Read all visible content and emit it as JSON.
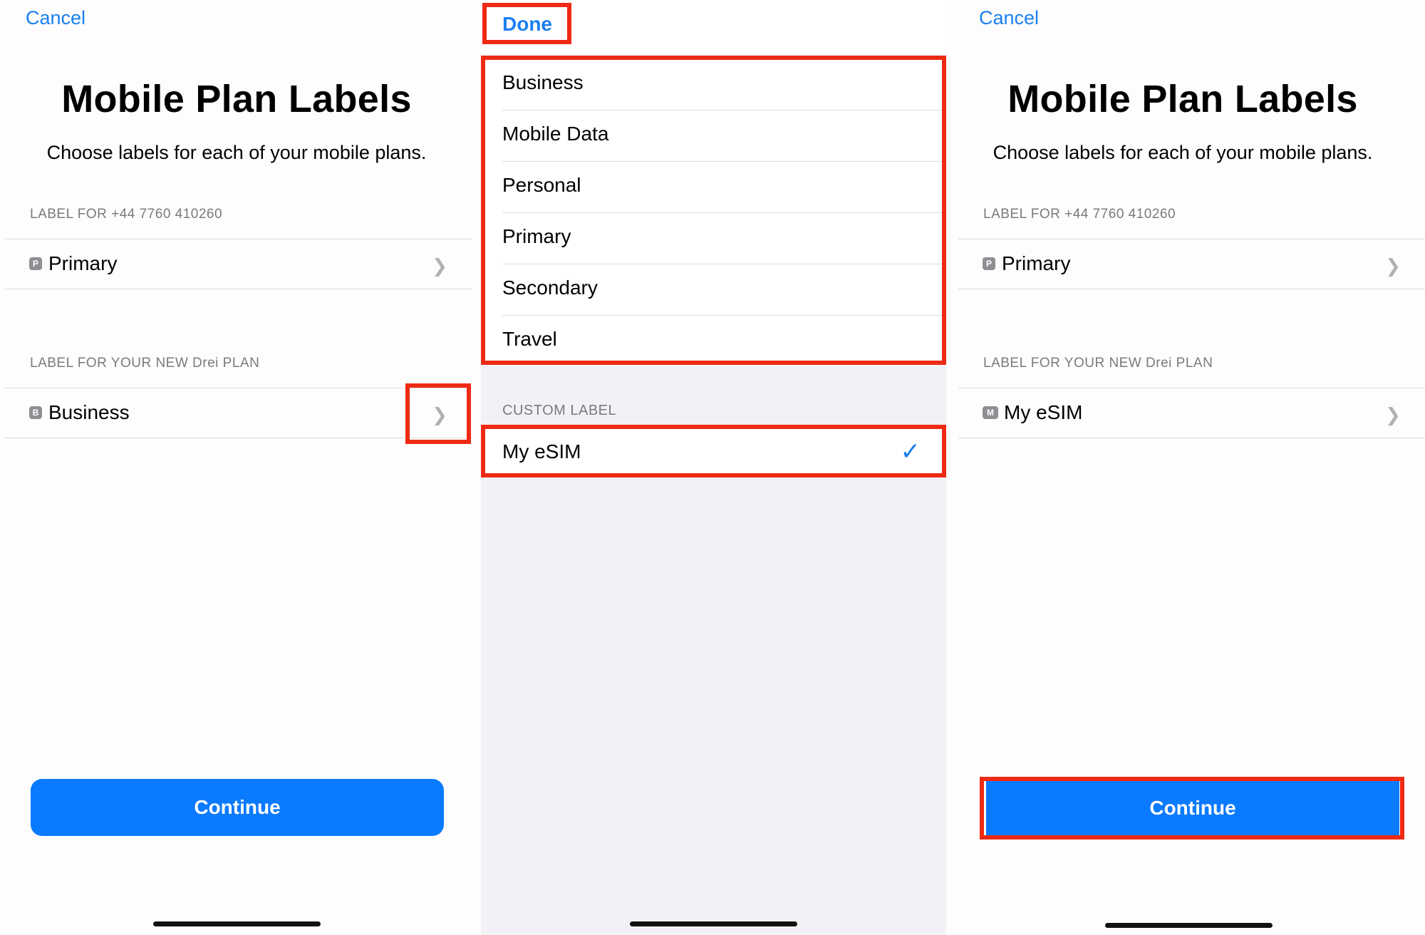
{
  "panel1": {
    "cancel": "Cancel",
    "title": "Mobile Plan Labels",
    "subtitle": "Choose labels for each of your mobile plans.",
    "section1_label": "LABEL FOR +44 7760 410260",
    "row1": {
      "badge": "P",
      "label": "Primary"
    },
    "section2_label": "LABEL FOR YOUR NEW Drei PLAN",
    "row2": {
      "badge": "B",
      "label": "Business"
    },
    "continue": "Continue"
  },
  "panel2": {
    "done": "Done",
    "options": [
      "Business",
      "Mobile Data",
      "Personal",
      "Primary",
      "Secondary",
      "Travel"
    ],
    "custom_label_header": "CUSTOM LABEL",
    "custom_value": "My eSIM",
    "check_icon": "✓"
  },
  "panel3": {
    "cancel": "Cancel",
    "title": "Mobile Plan Labels",
    "subtitle": "Choose labels for each of your mobile plans.",
    "section1_label": "LABEL FOR +44 7760 410260",
    "row1": {
      "badge": "P",
      "label": "Primary"
    },
    "section2_label": "LABEL FOR YOUR NEW Drei PLAN",
    "row2": {
      "badge": "M",
      "label": "My eSIM"
    },
    "continue": "Continue"
  },
  "colors": {
    "accent": "#1a7ff0",
    "button": "#0a7aff",
    "highlight": "#ef2a14"
  },
  "icons": {
    "chevron": "chevron-right-icon",
    "check": "checkmark-icon"
  }
}
